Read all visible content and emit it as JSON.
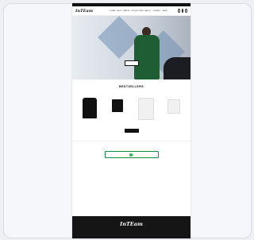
{
  "announcement": "",
  "header": {
    "logo": "InTEam",
    "nav": [
      {
        "label": "HOME"
      },
      {
        "label": "SHOP"
      },
      {
        "label": "NEW IN"
      },
      {
        "label": "COLLECTIONS"
      },
      {
        "label": "ABOUT"
      },
      {
        "label": "CONTACT"
      },
      {
        "label": "SALE"
      }
    ]
  },
  "hero": {
    "headline": "",
    "button": ""
  },
  "bestsellers": {
    "title": "BESTSELLERS",
    "products": [
      {
        "name": "",
        "price": "",
        "kind": "tee",
        "color": "#111111"
      },
      {
        "name": "",
        "price": "",
        "kind": "shorts",
        "color": "#111111"
      },
      {
        "name": "",
        "price": "",
        "kind": "tee",
        "color": "#f1f1f1"
      },
      {
        "name": "",
        "price": "",
        "kind": "shorts",
        "color": "#f1f1f1"
      }
    ],
    "view_all": ""
  },
  "whatsapp": {
    "title": "",
    "text": "",
    "button": ""
  },
  "footer": {
    "logo": "InTEam",
    "sub": ""
  },
  "colors": {
    "brand_green": "#1f5e35",
    "whatsapp_green": "#1fbf4a",
    "footer_bg": "#151515"
  }
}
